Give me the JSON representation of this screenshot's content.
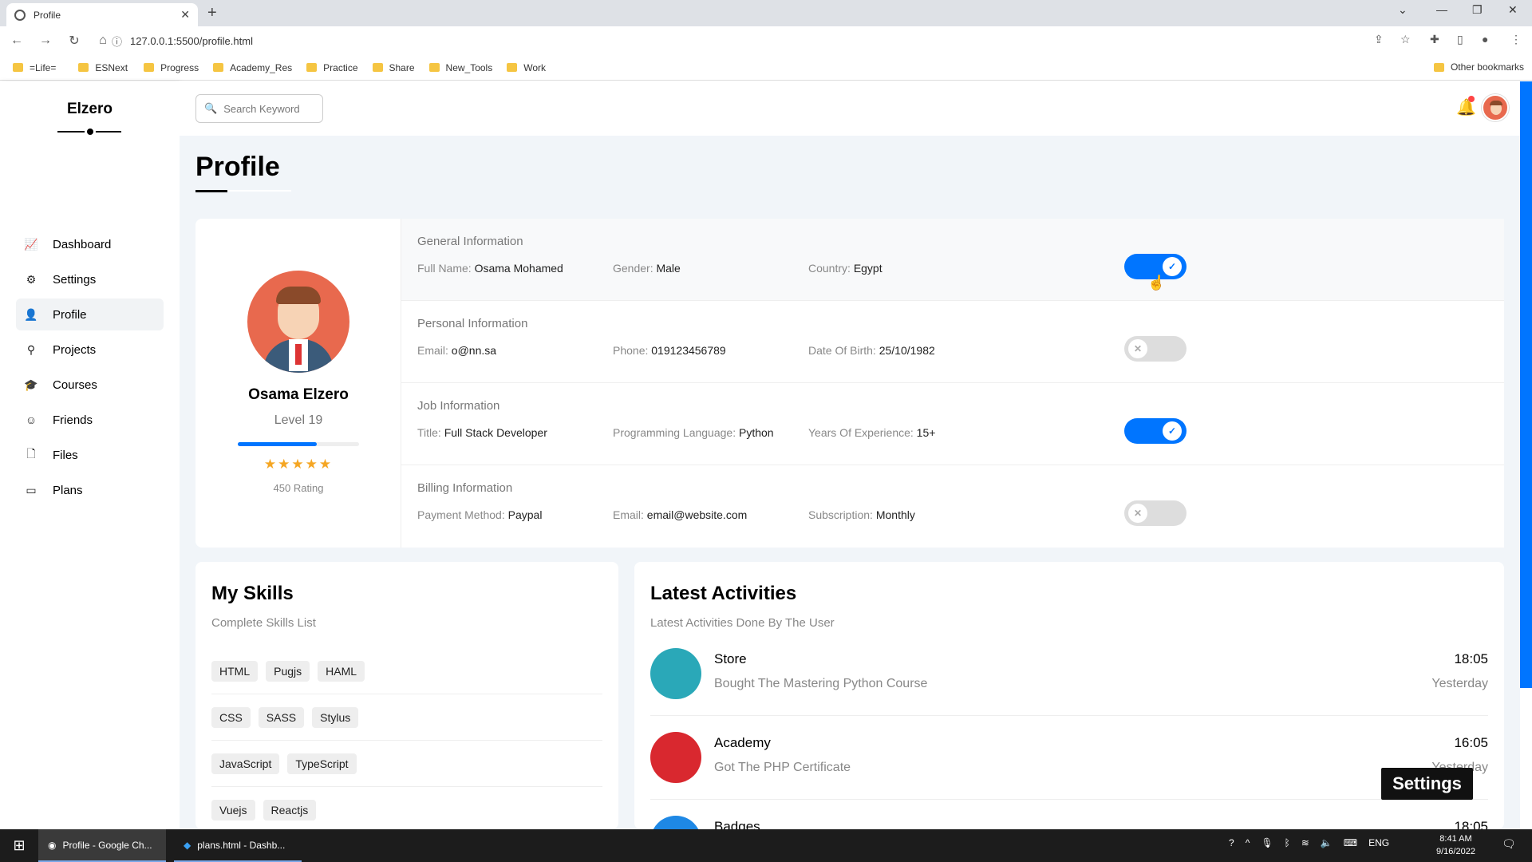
{
  "browser": {
    "tab_title": "Profile",
    "url": "127.0.0.1:5500/profile.html",
    "bookmarks": [
      "=Life=",
      "ESNext",
      "Progress",
      "Academy_Res",
      "Practice",
      "Share",
      "New_Tools",
      "Work"
    ],
    "other_bookmarks": "Other bookmarks"
  },
  "sidebar": {
    "brand": "Elzero",
    "items": [
      {
        "label": "Dashboard",
        "icon": "chart-icon"
      },
      {
        "label": "Settings",
        "icon": "gear-icon"
      },
      {
        "label": "Profile",
        "icon": "user-icon"
      },
      {
        "label": "Projects",
        "icon": "diagram-icon"
      },
      {
        "label": "Courses",
        "icon": "graduation-cap-icon"
      },
      {
        "label": "Friends",
        "icon": "friends-icon"
      },
      {
        "label": "Files",
        "icon": "file-icon"
      },
      {
        "label": "Plans",
        "icon": "credit-card-icon"
      }
    ],
    "active": "Profile"
  },
  "header": {
    "search_placeholder": "Search Keyword"
  },
  "page": {
    "title": "Profile"
  },
  "profile": {
    "name": "Osama Elzero",
    "level": "Level 19",
    "level_progress": 0.65,
    "stars": "★★★★★",
    "rating": "450 Rating"
  },
  "info_sections": [
    {
      "title": "General Information",
      "fields": [
        [
          "Full Name:",
          "Osama Mohamed"
        ],
        [
          "Gender:",
          "Male"
        ],
        [
          "Country:",
          "Egypt"
        ]
      ],
      "enabled": true
    },
    {
      "title": "Personal Information",
      "fields": [
        [
          "Email:",
          "o@nn.sa"
        ],
        [
          "Phone:",
          "019123456789"
        ],
        [
          "Date Of Birth:",
          "25/10/1982"
        ]
      ],
      "enabled": false
    },
    {
      "title": "Job Information",
      "fields": [
        [
          "Title:",
          "Full Stack Developer"
        ],
        [
          "Programming Language:",
          "Python"
        ],
        [
          "Years Of Experience:",
          "15+"
        ]
      ],
      "enabled": true
    },
    {
      "title": "Billing Information",
      "fields": [
        [
          "Payment Method:",
          "Paypal"
        ],
        [
          "Email:",
          "email@website.com"
        ],
        [
          "Subscription:",
          "Monthly"
        ]
      ],
      "enabled": false
    }
  ],
  "skills": {
    "title": "My Skills",
    "subtitle": "Complete Skills List",
    "rows": [
      [
        "HTML",
        "Pugjs",
        "HAML"
      ],
      [
        "CSS",
        "SASS",
        "Stylus"
      ],
      [
        "JavaScript",
        "TypeScript"
      ],
      [
        "Vuejs",
        "Reactjs"
      ]
    ]
  },
  "activities": {
    "title": "Latest Activities",
    "subtitle": "Latest Activities Done By The User",
    "items": [
      {
        "title": "Store",
        "desc": "Bought The Mastering Python Course",
        "time": "18:05",
        "day": "Yesterday",
        "color": "#2aa8b8"
      },
      {
        "title": "Academy",
        "desc": "Got The PHP Certificate",
        "time": "16:05",
        "day": "Yesterday",
        "color": "#d9282f"
      },
      {
        "title": "Badges",
        "desc": "",
        "time": "18:05",
        "day": "",
        "color": "#1e88e5"
      }
    ]
  },
  "tooltip": "Settings",
  "taskbar": {
    "tasks": [
      "Profile - Google Ch...",
      "plans.html - Dashb..."
    ],
    "lang": "ENG",
    "time": "8:41 AM",
    "date": "9/16/2022"
  }
}
